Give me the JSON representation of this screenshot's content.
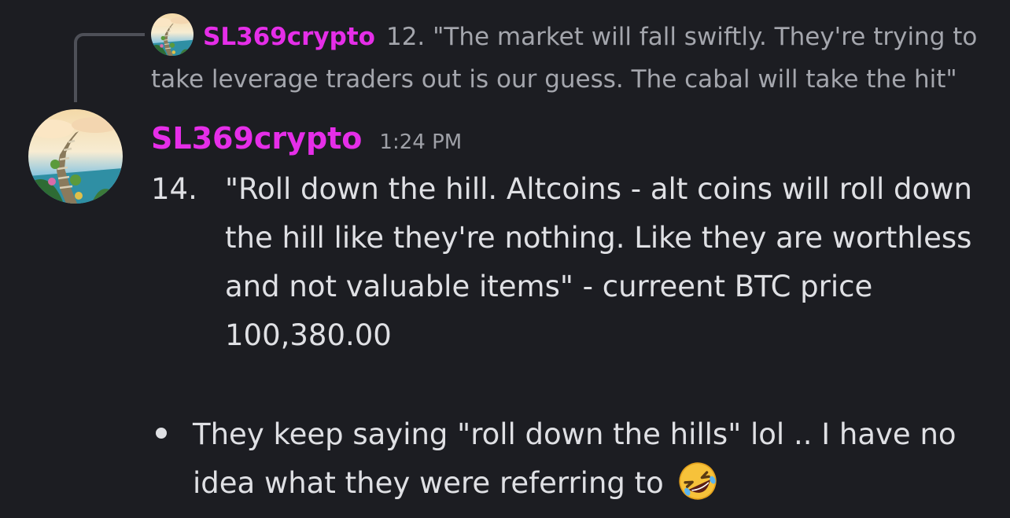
{
  "reply": {
    "author": "SL369crypto",
    "snippet": "12.  \"The market will fall swiftly. They're trying to take leverage traders out is our guess. The cabal will take the hit\""
  },
  "message": {
    "author": "SL369crypto",
    "timestamp": "1:24 PM",
    "list_number": "14.",
    "list_text": "\"Roll down the hill. Altcoins - alt coins will roll down the hill like they're nothing. Like they are worthless and not valuable items\" - curreent BTC price 100,380.00",
    "bullet_text": "They keep saying \"roll down the hills\" lol .. I have no idea what they were referring to",
    "emoji": "rolling-on-floor-laughing-emoji"
  },
  "colors": {
    "background": "#1c1d22",
    "author": "#e52ee8",
    "text": "#dfe0e4",
    "muted": "#a4a6ad",
    "reply_line": "#4e5058"
  }
}
